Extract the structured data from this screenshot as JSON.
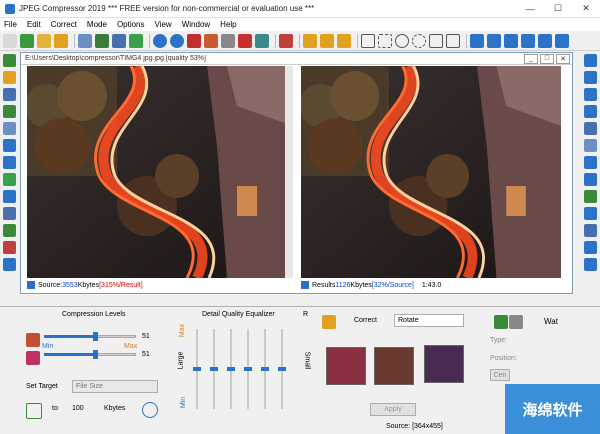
{
  "window": {
    "title": "JPEG Compressor 2019  ***  FREE version for non-commercial or evaluation use  ***",
    "controls": [
      "—",
      "☐",
      "✕"
    ]
  },
  "menu": [
    "File",
    "Edit",
    "Correct",
    "Mode",
    "Options",
    "View",
    "Window",
    "Help"
  ],
  "document": {
    "title": "E:\\Users\\Desktop\\compressor\\TIMG4 jpg.jpg  [quality 53%]"
  },
  "status_left": {
    "prefix": "Source: ",
    "size": "3553",
    "unit": " Kbytes  ",
    "ratio": "[315%/Result]"
  },
  "status_right": {
    "prefix": "Results ",
    "size": "1126",
    "unit": " Kbytes  ",
    "ratio": "[32%/Source]",
    "zoom": "1:43.0"
  },
  "compression": {
    "title": "Compression Levels",
    "min": "Min",
    "max": "Max",
    "value1": "51",
    "value2": "51",
    "fill1": 0.55,
    "fill2": 0.55
  },
  "target": {
    "label": "Set Target",
    "select": "File Size",
    "to": "to",
    "value": "100",
    "unit": "Kbytes"
  },
  "equalizer": {
    "title": "Detail Quality Equalizer",
    "left": "Large",
    "right": "Small",
    "top": "R",
    "min": "Min",
    "max": "Max",
    "levels": [
      0.5,
      0.5,
      0.5,
      0.5,
      0.5,
      0.5
    ]
  },
  "correct": {
    "label": "Correct",
    "select": "Rotate",
    "apply": "Apply",
    "source": "Source: [364x455]"
  },
  "watermark": {
    "label": "Wat",
    "type": "Type:",
    "pos": "Position:",
    "cen": "Cen"
  },
  "brand": {
    "text": "海绵软件"
  }
}
